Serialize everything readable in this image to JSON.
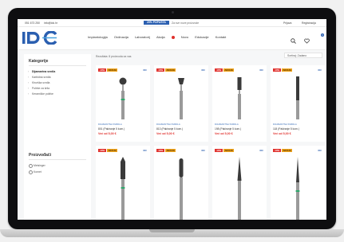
{
  "topbar": {
    "phone": "051 673 250",
    "email": "info@idc.hr",
    "promo_badge": "20% POPUSTA",
    "promo_text": "Za sve nove proizvode",
    "store_link": "Prijava",
    "register_link": "Registracija"
  },
  "header": {
    "logo_text": "IDC",
    "nav": [
      "Implantologija",
      "Ordinacija",
      "Laboratorij",
      "Akcija",
      "Novo",
      "Edukacije",
      "Kontakt"
    ],
    "cart_count": "0",
    "icons": [
      "search-icon",
      "heart-icon",
      "cart-icon"
    ]
  },
  "sidebar": {
    "category_title": "Kategorije",
    "categories": [
      "Dijamantna svrdla",
      "Karbidna svrdla",
      "Kirurška svrdla",
      "Polirke za krila",
      "Keramičke polirke"
    ],
    "active_index": 0,
    "producers_title": "Proizvođači",
    "producers": [
      "Meisinger",
      "Komet"
    ]
  },
  "main": {
    "results_text": "Rezultata: 8 proizvoda za vas",
    "sort_label": "Sortiraj: Zadano",
    "products": [
      {
        "category": "DIJAMANTNA SVRDLA",
        "name": "801 (Pakiranje 5 kom.)",
        "price": "Već od 5,00 €",
        "discount": "-10%",
        "tag": "AKCIJA",
        "brand": "IDC",
        "shape": "ball"
      },
      {
        "category": "DIJAMANTNA SVRDLA",
        "name": "813 (Pakiranje 5 kom.)",
        "price": "Već od 5,00 €",
        "discount": "-10%",
        "tag": "AKCIJA",
        "brand": "IDC",
        "shape": "inverted"
      },
      {
        "category": "DIJAMANTNA SVRDLA",
        "name": "198 (Pakiranje 5 kom.)",
        "price": "Već od 5,00 €",
        "discount": "-10%",
        "tag": "AKCIJA",
        "brand": "IDC",
        "shape": "cylinder"
      },
      {
        "category": "DIJAMANTNA SVRDLA",
        "name": "118 (Pakiranje 5 kom.)",
        "price": "Već od 5,00 €",
        "discount": "-10%",
        "tag": "AKCIJA",
        "brand": "IDC",
        "shape": "long"
      },
      {
        "category": "",
        "name": "",
        "price": "",
        "discount": "-10%",
        "tag": "AKCIJA",
        "brand": "IDC",
        "shape": "flame"
      },
      {
        "category": "",
        "name": "",
        "price": "",
        "discount": "-10%",
        "tag": "AKCIJA",
        "brand": "IDC",
        "shape": "ball-long"
      },
      {
        "category": "",
        "name": "",
        "price": "",
        "discount": "-10%",
        "tag": "AKCIJA",
        "brand": "IDC",
        "shape": "taper"
      },
      {
        "category": "",
        "name": "",
        "price": "",
        "discount": "-10%",
        "tag": "AKCIJA",
        "brand": "IDC",
        "shape": "needle"
      }
    ]
  },
  "colors": {
    "accent": "#2b5fb0",
    "sale": "#e0302c",
    "badge_yellow": "#f0a41c",
    "green_band": "#2fa86c"
  }
}
